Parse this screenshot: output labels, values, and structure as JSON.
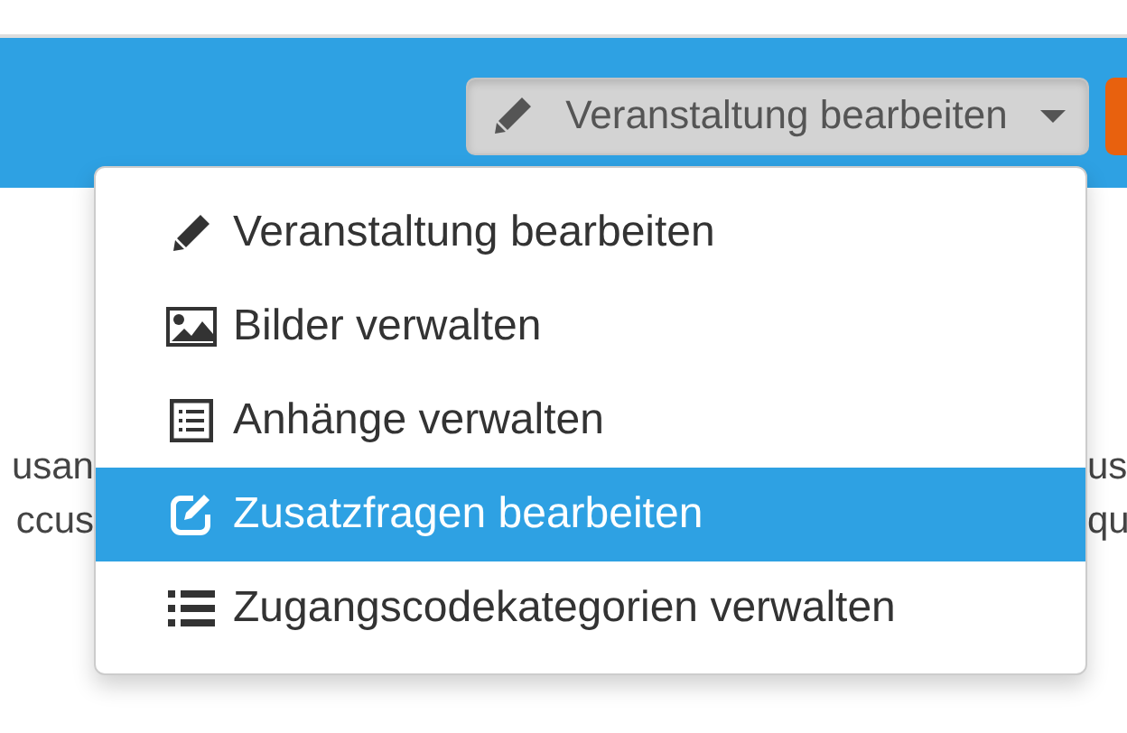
{
  "toolbar": {
    "edit_button": {
      "label": "Veranstaltung bearbeiten",
      "expanded": true
    }
  },
  "menu": {
    "items": [
      {
        "label": "Veranstaltung bearbeiten",
        "selected": false
      },
      {
        "label": "Bilder verwalten",
        "selected": false
      },
      {
        "label": "Anhänge verwalten",
        "selected": false
      },
      {
        "label": "Zusatzfragen bearbeiten",
        "selected": true
      },
      {
        "label": "Zugangscodekategorien verwalten",
        "selected": false
      }
    ]
  },
  "background_text": {
    "left": [
      "usan",
      "ccus"
    ],
    "right": [
      "us",
      "qu"
    ]
  }
}
